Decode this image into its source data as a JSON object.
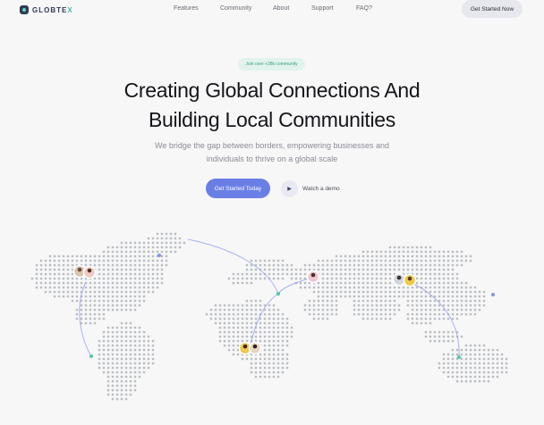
{
  "brand": {
    "name_main": "GLOBTE",
    "name_accent": "X"
  },
  "nav": {
    "links": [
      "Features",
      "Community",
      "About",
      "Support",
      "FAQ?"
    ],
    "cta": "Get Started Now"
  },
  "hero": {
    "badge": "Join over +28k community",
    "title_line1": "Creating Global Connections And",
    "title_line2": "Building Local Communities",
    "subtitle_line1": "We bridge the gap between borders, empowering businesses and",
    "subtitle_line2": "individuals to thrive on a global scale",
    "primary_button": "Get Started Today",
    "demo_label": "Watch a demo",
    "demo_icon": "play-icon"
  },
  "colors": {
    "accent": "#6a7fe6",
    "teal": "#46b5a8",
    "dots": "#b9bcc2",
    "arc": "#9aa5ec"
  }
}
